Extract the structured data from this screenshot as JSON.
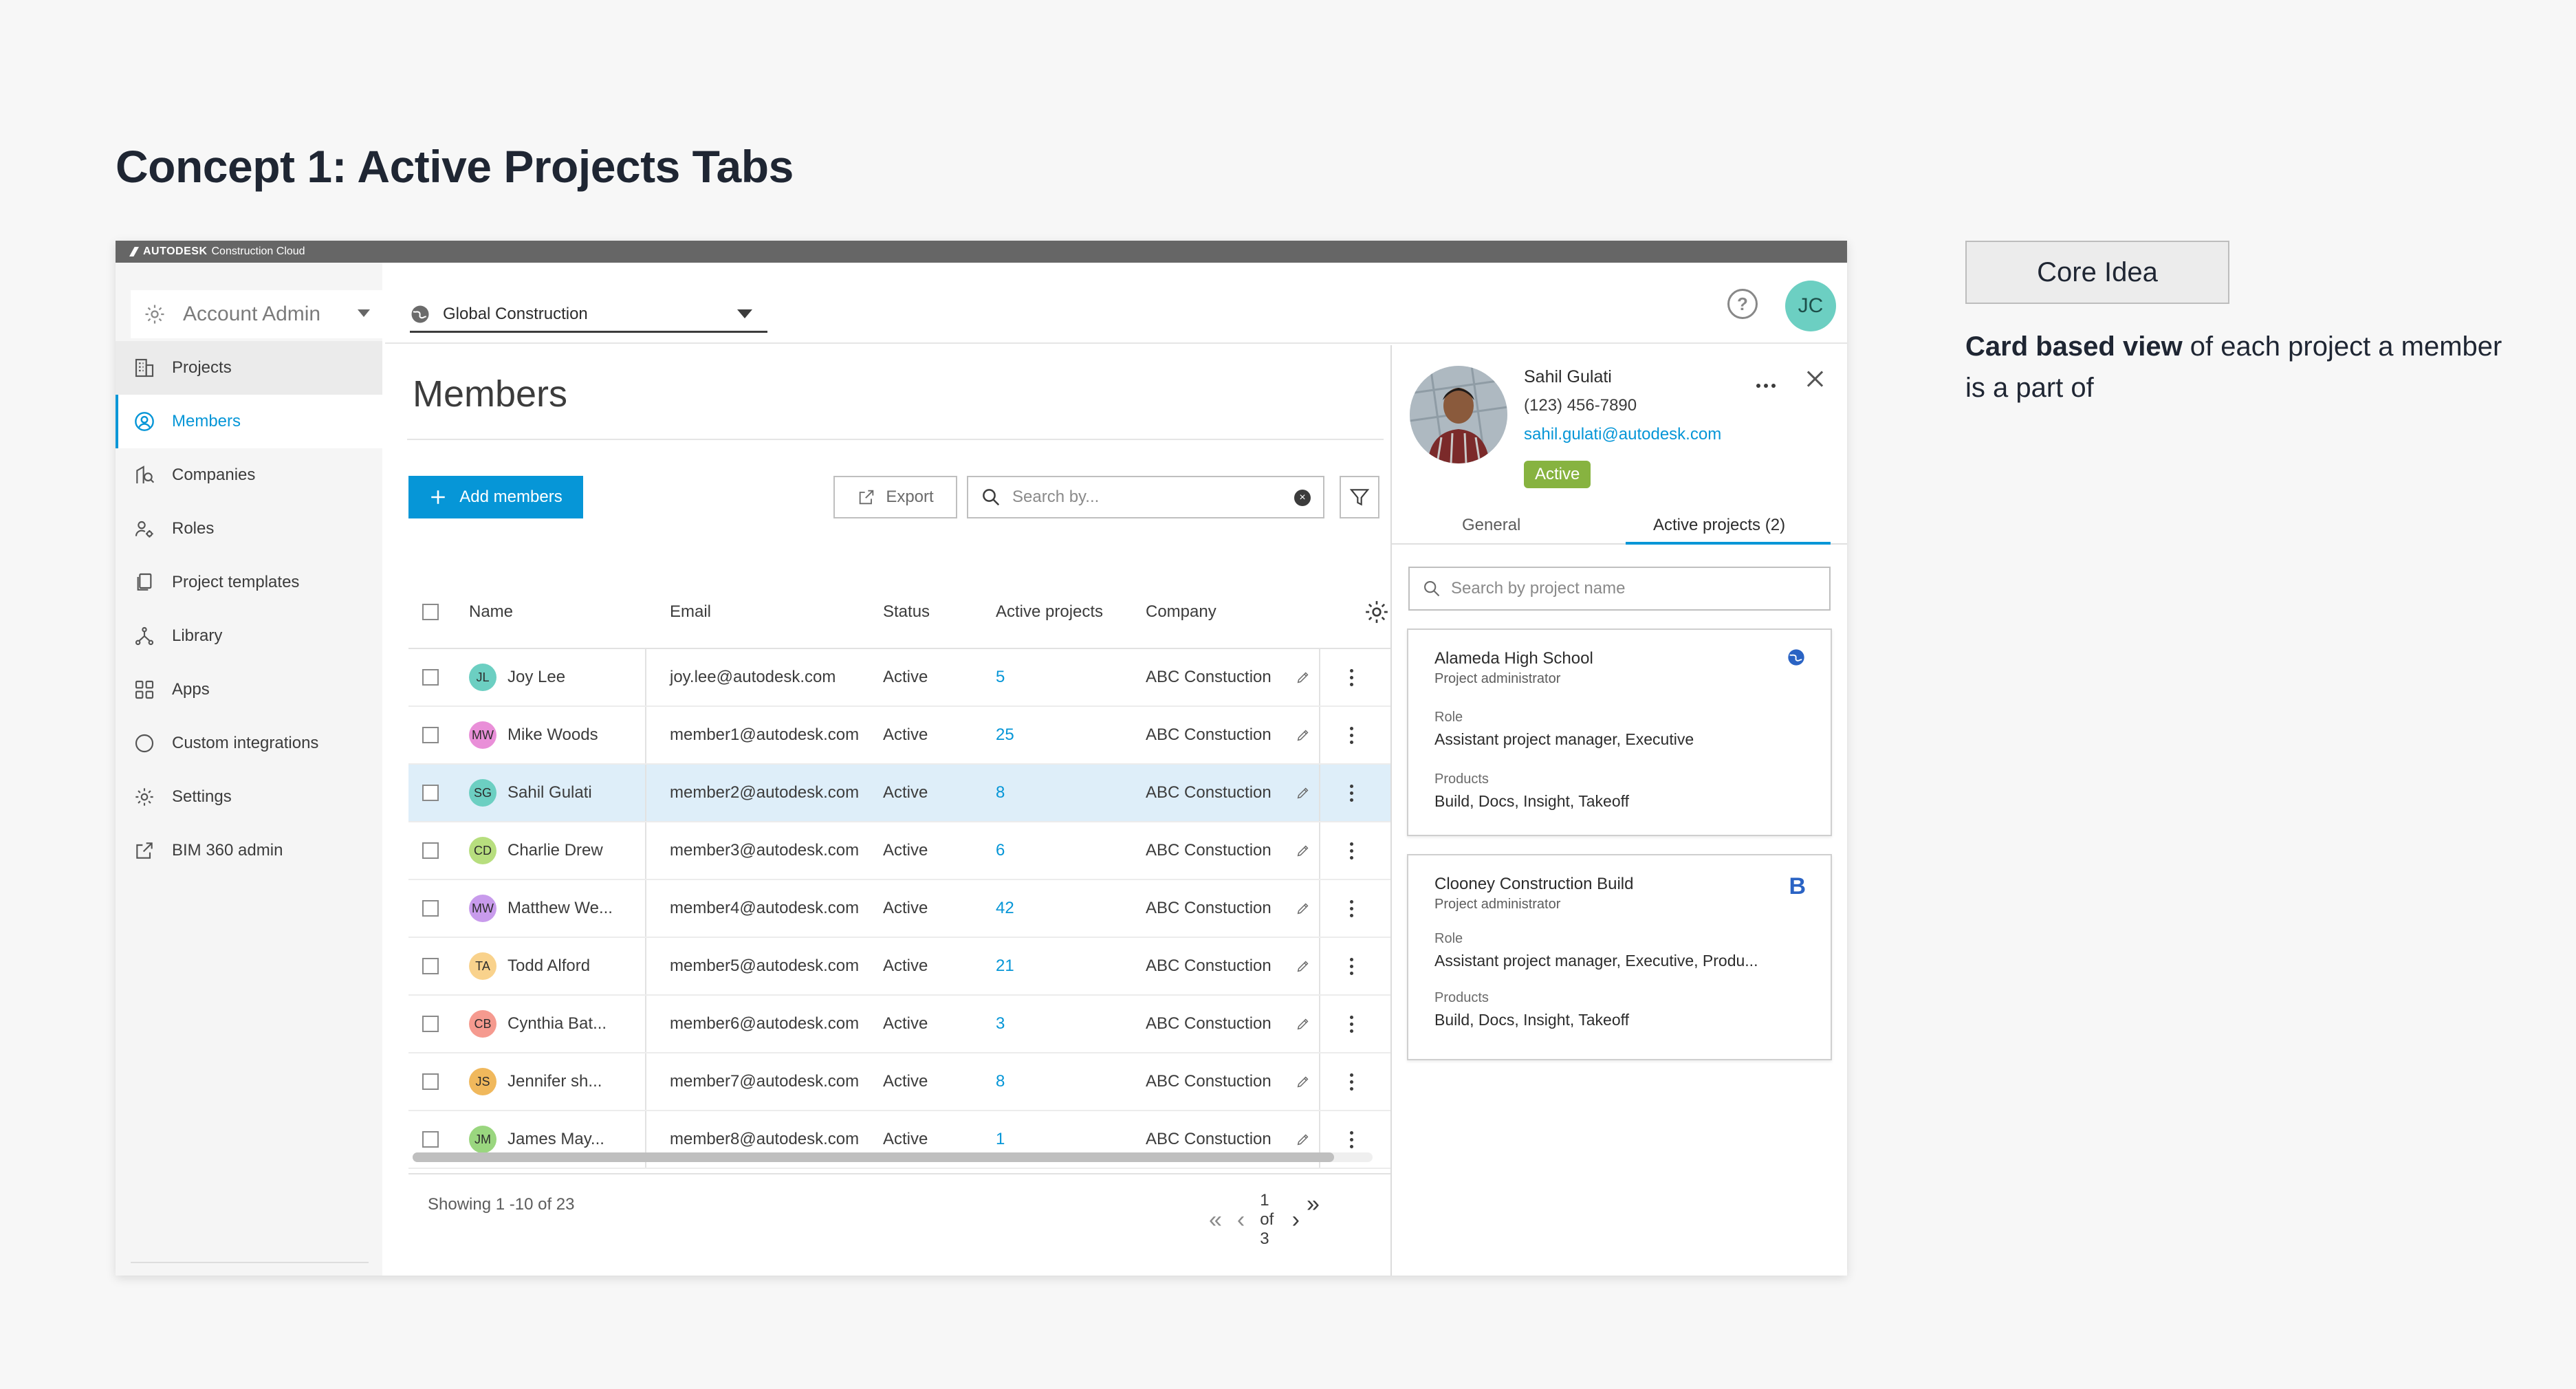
{
  "concept_title": "Concept 1: Active Projects Tabs",
  "brand": {
    "bold": "AUTODESK",
    "product": "Construction Cloud"
  },
  "sidebar": {
    "account_label": "Account Admin",
    "items": [
      {
        "label": "Projects",
        "icon": "building-icon"
      },
      {
        "label": "Members",
        "icon": "person-circle-icon"
      },
      {
        "label": "Companies",
        "icon": "company-icon"
      },
      {
        "label": "Roles",
        "icon": "roles-icon"
      },
      {
        "label": "Project templates",
        "icon": "templates-icon"
      },
      {
        "label": "Library",
        "icon": "library-icon"
      },
      {
        "label": "Apps",
        "icon": "apps-grid-icon"
      },
      {
        "label": "Custom integrations",
        "icon": "circle-icon"
      },
      {
        "label": "Settings",
        "icon": "gear-icon"
      },
      {
        "label": "BIM 360 admin",
        "icon": "external-link-icon"
      }
    ]
  },
  "topbar": {
    "project": "Global Construction",
    "help": "?",
    "user_initials": "JC"
  },
  "members": {
    "title": "Members",
    "add_label": "Add members",
    "export_label": "Export",
    "search_placeholder": "Search by...",
    "columns": {
      "name": "Name",
      "email": "Email",
      "status": "Status",
      "active": "Active projects",
      "company": "Company"
    },
    "rows": [
      {
        "initials": "JL",
        "color": "#6ccfc2",
        "name": "Joy Lee",
        "email": "joy.lee@autodesk.com",
        "status": "Active",
        "active": "5",
        "company": "ABC Constuction"
      },
      {
        "initials": "MW",
        "color": "#e98fd8",
        "name": "Mike Woods",
        "email": "member1@autodesk.com",
        "status": "Active",
        "active": "25",
        "company": "ABC Constuction"
      },
      {
        "initials": "SG",
        "color": "#6ccfc2",
        "name": "Sahil Gulati",
        "email": "member2@autodesk.com",
        "status": "Active",
        "active": "8",
        "company": "ABC Constuction"
      },
      {
        "initials": "CD",
        "color": "#b7de7e",
        "name": "Charlie Drew",
        "email": "member3@autodesk.com",
        "status": "Active",
        "active": "6",
        "company": "ABC Constuction"
      },
      {
        "initials": "MW",
        "color": "#c89bec",
        "name": "Matthew We...",
        "email": "member4@autodesk.com",
        "status": "Active",
        "active": "42",
        "company": "ABC Constuction"
      },
      {
        "initials": "TA",
        "color": "#f9d28c",
        "name": "Todd Alford",
        "email": "member5@autodesk.com",
        "status": "Active",
        "active": "21",
        "company": "ABC Constuction"
      },
      {
        "initials": "CB",
        "color": "#f59a8f",
        "name": "Cynthia Bat...",
        "email": "member6@autodesk.com",
        "status": "Active",
        "active": "3",
        "company": "ABC Constuction"
      },
      {
        "initials": "JS",
        "color": "#f0b85c",
        "name": "Jennifer sh...",
        "email": "member7@autodesk.com",
        "status": "Active",
        "active": "8",
        "company": "ABC Constuction"
      },
      {
        "initials": "JM",
        "color": "#9ad67f",
        "name": "James May...",
        "email": "member8@autodesk.com",
        "status": "Active",
        "active": "1",
        "company": "ABC Constuction"
      }
    ],
    "selected_index": 2,
    "showing": "Showing 1 -10 of 23",
    "page": "1 of 3"
  },
  "panel": {
    "name": "Sahil Gulati",
    "phone": "(123) 456-7890",
    "email": "sahil.gulati@autodesk.com",
    "status": "Active",
    "tab_general": "General",
    "tab_active": "Active projects (2)",
    "search_placeholder": "Search by project name",
    "cards": [
      {
        "title": "Alameda High School",
        "role": "Project administrator",
        "role_label": "Role",
        "role_value": "Assistant project manager, Executive",
        "products_label": "Products",
        "products_value": "Build, Docs, Insight, Takeoff",
        "icon": "globe-icon"
      },
      {
        "title": "Clooney Construction Build",
        "role": "Project administrator",
        "role_label": "Role",
        "role_value": "Assistant project manager, Executive, Produ...",
        "products_label": "Products",
        "products_value": "Build, Docs, Insight, Takeoff",
        "icon": "b-logo-icon",
        "icon_text": "B"
      }
    ]
  },
  "core": {
    "button": "Core Idea",
    "desc_bold": "Card based view",
    "desc_rest": " of each project a member is a part of"
  },
  "colors": {
    "accent": "#0696d7",
    "active_badge": "#87b340",
    "selected_row": "#deeef9"
  }
}
